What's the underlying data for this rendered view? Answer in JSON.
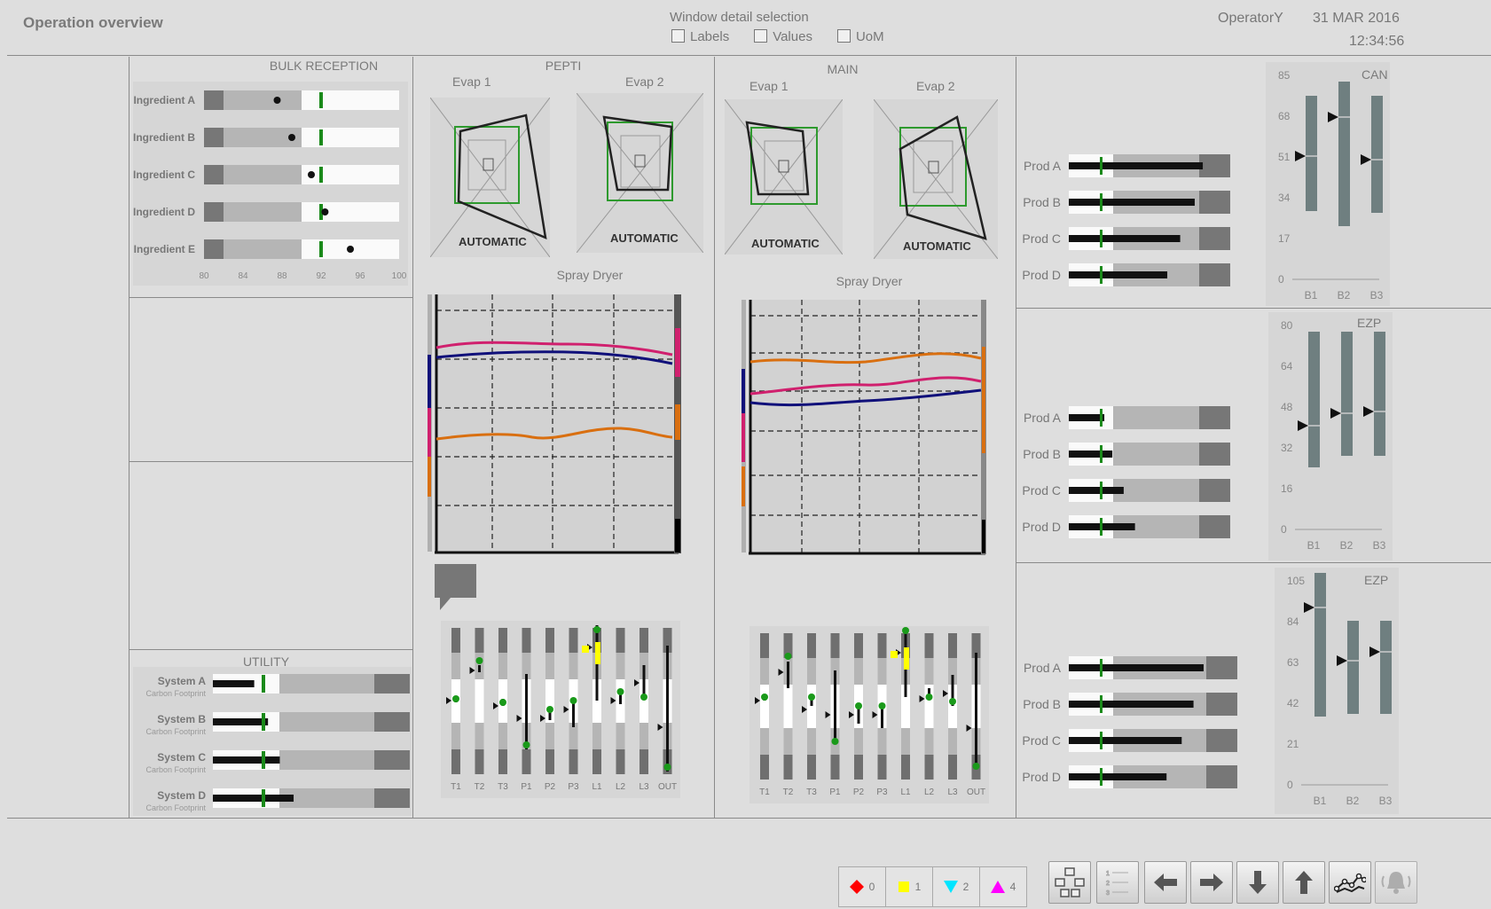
{
  "header": {
    "title": "Operation overview",
    "window_detail": {
      "label": "Window detail selection",
      "options": [
        {
          "label": "Labels",
          "checked": false
        },
        {
          "label": "Values",
          "checked": false
        },
        {
          "label": "UoM",
          "checked": false
        }
      ]
    },
    "operator": "OperatorY",
    "date": "31 MAR 2016",
    "time": "12:34:56"
  },
  "bulk_reception": {
    "title": "BULK RECEPTION",
    "rows": [
      {
        "label": "Ingredient A",
        "value": 87.5
      },
      {
        "label": "Ingredient B",
        "value": 89
      },
      {
        "label": "Ingredient C",
        "value": 91
      },
      {
        "label": "Ingredient D",
        "value": 92.4
      },
      {
        "label": "Ingredient E",
        "value": 95
      }
    ],
    "target": 92,
    "axis": [
      "80",
      "84",
      "88",
      "92",
      "96",
      "100"
    ]
  },
  "utility": {
    "title": "UTILITY",
    "rows": [
      {
        "label": "System A",
        "sub": "Carbon Footprint",
        "value": 0.21
      },
      {
        "label": "System B",
        "sub": "Carbon Footprint",
        "value": 0.28
      },
      {
        "label": "System C",
        "sub": "Carbon Footprint",
        "value": 0.34
      },
      {
        "label": "System D",
        "sub": "Carbon Footprint",
        "value": 0.41
      }
    ]
  },
  "pepti": {
    "title": "PEPTI",
    "evap1": {
      "label": "Evap 1",
      "mode": "AUTOMATIC"
    },
    "evap2": {
      "label": "Evap 2",
      "mode": "AUTOMATIC"
    },
    "spray_title": "Spray Dryer",
    "temps": [
      "T1",
      "T2",
      "T3",
      "P1",
      "P2",
      "P3",
      "L1",
      "L2",
      "L3",
      "OUT"
    ]
  },
  "main": {
    "title": "MAIN",
    "evap1": {
      "label": "Evap 1",
      "mode": "AUTOMATIC"
    },
    "evap2": {
      "label": "Evap 2",
      "mode": "AUTOMATIC"
    },
    "spray_title": "Spray Dryer",
    "temps": [
      "T1",
      "T2",
      "T3",
      "P1",
      "P2",
      "P3",
      "L1",
      "L2",
      "L3",
      "OUT"
    ]
  },
  "can": {
    "title": "CAN",
    "prods": [
      {
        "label": "Prod A",
        "value": 0.83
      },
      {
        "label": "Prod B",
        "value": 0.78
      },
      {
        "label": "Prod C",
        "value": 0.69
      },
      {
        "label": "Prod D",
        "value": 0.61
      }
    ],
    "axis": [
      "85",
      "68",
      "51",
      "34",
      "17",
      "0"
    ],
    "bins": [
      "B1",
      "B2",
      "B3"
    ]
  },
  "ezp1": {
    "title": "EZP",
    "prods": [
      {
        "label": "Prod A",
        "value": 0.22
      },
      {
        "label": "Prod B",
        "value": 0.27
      },
      {
        "label": "Prod C",
        "value": 0.34
      },
      {
        "label": "Prod D",
        "value": 0.41
      }
    ],
    "axis": [
      "80",
      "64",
      "48",
      "32",
      "16",
      "0"
    ],
    "bins": [
      "B1",
      "B2",
      "B3"
    ]
  },
  "ezp2": {
    "title": "EZP",
    "prods": [
      {
        "label": "Prod A",
        "value": 0.8
      },
      {
        "label": "Prod B",
        "value": 0.74
      },
      {
        "label": "Prod C",
        "value": 0.67
      },
      {
        "label": "Prod D",
        "value": 0.58
      }
    ],
    "axis": [
      "105",
      "84",
      "63",
      "42",
      "21",
      "0"
    ],
    "bins": [
      "B1",
      "B2",
      "B3"
    ]
  },
  "alarms": [
    {
      "count": "0",
      "color": "#ff0000",
      "shape": "diamond"
    },
    {
      "count": "1",
      "color": "#ffff00",
      "shape": "square"
    },
    {
      "count": "2",
      "color": "#00e5ff",
      "shape": "triangle-down"
    },
    {
      "count": "4",
      "color": "#ff00ff",
      "shape": "triangle-up"
    }
  ],
  "toolbar_icons": [
    "hierarchy-icon",
    "list-icon",
    "arrow-left-icon",
    "arrow-right-icon",
    "arrow-down-icon",
    "arrow-up-icon",
    "trend-icon",
    "alarm-bell-icon"
  ]
}
